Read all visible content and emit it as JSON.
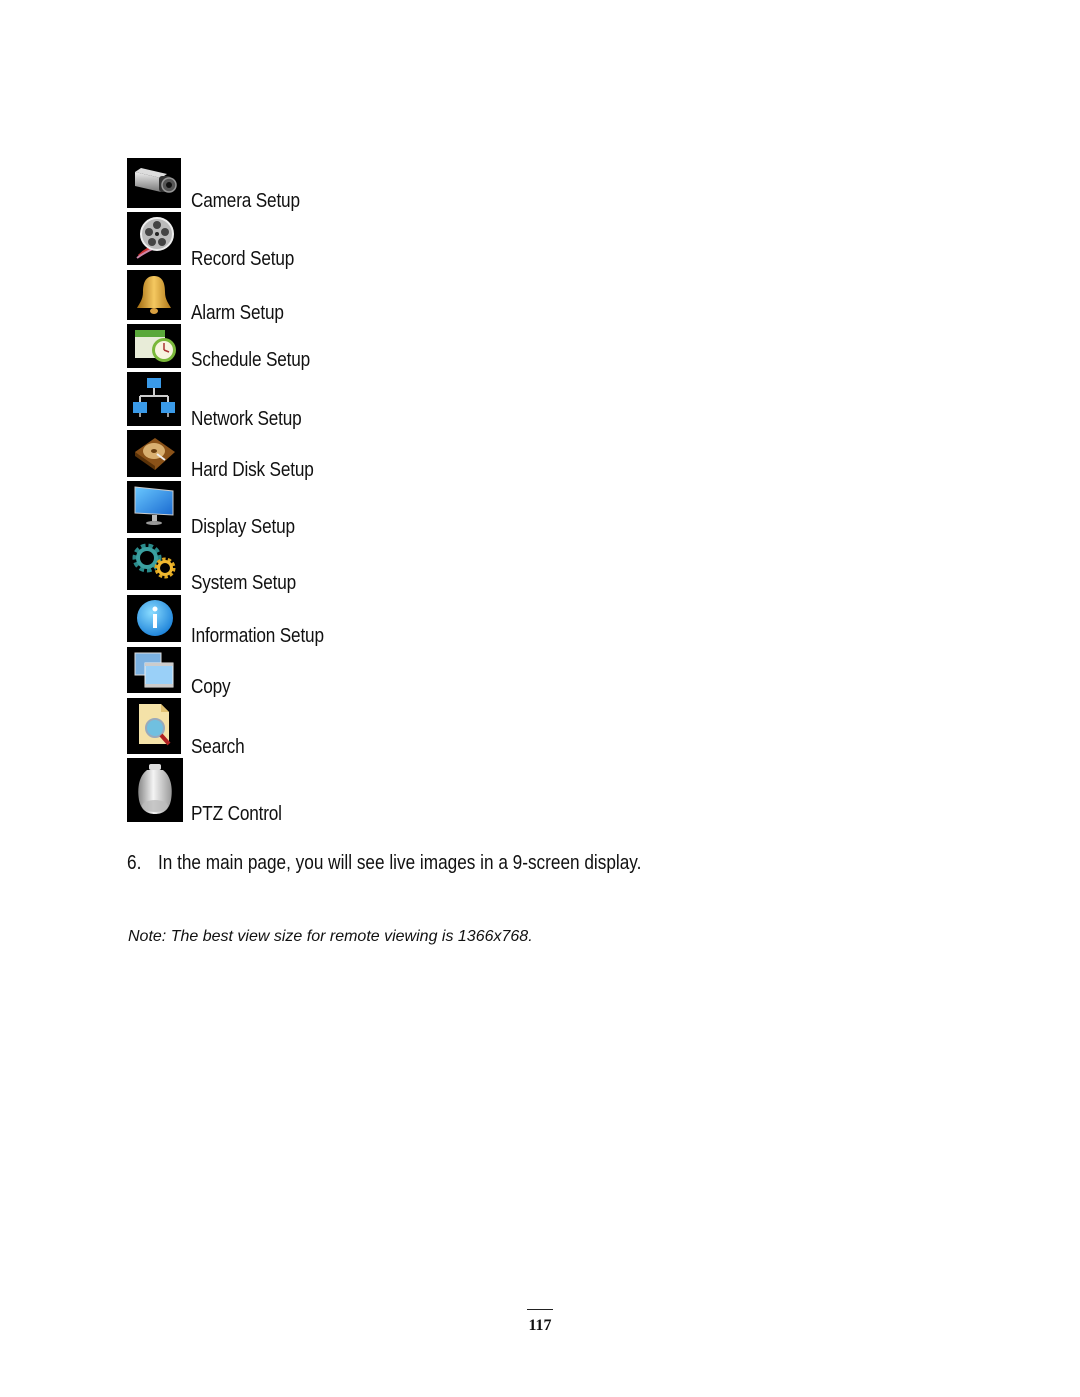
{
  "menu_items": [
    {
      "label": "Camera Setup",
      "icon": "camera-icon"
    },
    {
      "label": "Record Setup",
      "icon": "film-reel-icon"
    },
    {
      "label": "Alarm Setup",
      "icon": "bell-icon"
    },
    {
      "label": "Schedule Setup",
      "icon": "calendar-clock-icon"
    },
    {
      "label": "Network Setup",
      "icon": "network-icon"
    },
    {
      "label": "Hard Disk Setup",
      "icon": "hard-disk-icon"
    },
    {
      "label": "Display Setup",
      "icon": "monitor-icon"
    },
    {
      "label": "System Setup",
      "icon": "gears-icon"
    },
    {
      "label": "Information Setup",
      "icon": "info-icon"
    },
    {
      "label": "Copy",
      "icon": "copy-film-icon"
    },
    {
      "label": "Search",
      "icon": "search-document-icon"
    },
    {
      "label": "PTZ Control",
      "icon": "dome-camera-icon"
    }
  ],
  "step": {
    "number": "6.",
    "text": "In the main page, you will see live images in a 9-screen display."
  },
  "note": "Note: The best view size for remote viewing is 1366x768.",
  "page_number": "117"
}
